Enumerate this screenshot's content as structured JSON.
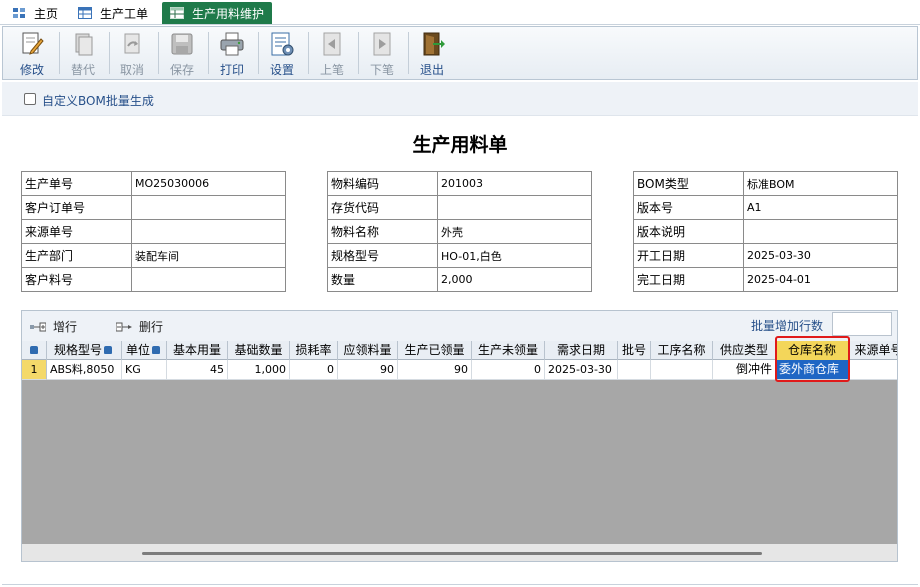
{
  "tabs": [
    {
      "label": "主页",
      "icon": "home-icon"
    },
    {
      "label": "生产工单",
      "icon": "table-icon"
    },
    {
      "label": "生产用料维护",
      "icon": "table-icon"
    }
  ],
  "toolbar": {
    "edit": "修改",
    "replace": "替代",
    "cancel": "取消",
    "save": "保存",
    "print": "打印",
    "settings": "设置",
    "prev": "上笔",
    "next": "下笔",
    "exit": "退出"
  },
  "options": {
    "custom_bom_label": "自定义BOM批量生成",
    "custom_bom_checked": false
  },
  "form_title": "生产用料单",
  "info_left": [
    {
      "label": "生产单号",
      "value": "MO25030006"
    },
    {
      "label": "客户订单号",
      "value": ""
    },
    {
      "label": "来源单号",
      "value": ""
    },
    {
      "label": "生产部门",
      "value": "装配车间"
    },
    {
      "label": "客户料号",
      "value": ""
    }
  ],
  "info_mid": [
    {
      "label": "物料编码",
      "value": "201003"
    },
    {
      "label": "存货代码",
      "value": ""
    },
    {
      "label": "物料名称",
      "value": "外壳"
    },
    {
      "label": "规格型号",
      "value": "HO-01,白色"
    },
    {
      "label": "数量",
      "value": "2,000"
    }
  ],
  "info_right": [
    {
      "label": "BOM类型",
      "value": "标准BOM"
    },
    {
      "label": "版本号",
      "value": "A1"
    },
    {
      "label": "版本说明",
      "value": ""
    },
    {
      "label": "开工日期",
      "value": "2025-03-30"
    },
    {
      "label": "完工日期",
      "value": "2025-04-01"
    }
  ],
  "grid_toolbar": {
    "add_row": "增行",
    "delete_row": "删行",
    "batch_label": "批量增加行数",
    "batch_value": ""
  },
  "grid": {
    "columns": [
      "规格型号",
      "单位",
      "基本用量",
      "基础数量",
      "损耗率",
      "应领料量",
      "生产已领量",
      "生产未领量",
      "需求日期",
      "批号",
      "工序名称",
      "供应类型",
      "仓库名称",
      "来源单号"
    ],
    "rows": [
      {
        "row_no": "1",
        "spec": "ABS料,8050",
        "unit": "KG",
        "basic_usage": "45",
        "base_qty": "1,000",
        "loss_rate": "0",
        "required_qty": "90",
        "issued_qty": "90",
        "unissued_qty": "0",
        "demand_date": "2025-03-30",
        "batch_no": "",
        "process_name": "",
        "supply_type": "倒冲件",
        "warehouse": "委外商仓库",
        "source_no": ""
      }
    ]
  }
}
